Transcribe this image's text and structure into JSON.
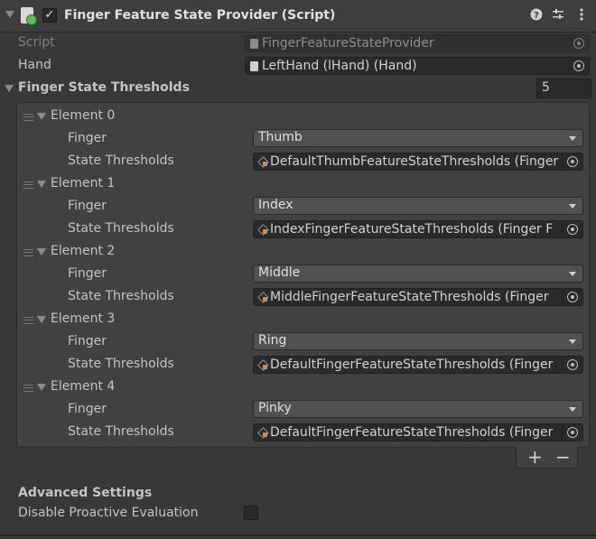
{
  "component": {
    "title": "Finger Feature State Provider (Script)",
    "enabled": true
  },
  "fields": {
    "script_label": "Script",
    "script_value": "FingerFeatureStateProvider",
    "hand_label": "Hand",
    "hand_value": "LeftHand (lHand) (Hand)"
  },
  "thresholds": {
    "label": "Finger State Thresholds",
    "size": "5",
    "finger_label": "Finger",
    "state_label": "State Thresholds",
    "elements": [
      {
        "name": "Element 0",
        "finger": "Thumb",
        "state": "DefaultThumbFeatureStateThresholds (Finger"
      },
      {
        "name": "Element 1",
        "finger": "Index",
        "state": "IndexFingerFeatureStateThresholds (Finger F"
      },
      {
        "name": "Element 2",
        "finger": "Middle",
        "state": "MiddleFingerFeatureStateThresholds (Finger"
      },
      {
        "name": "Element 3",
        "finger": "Ring",
        "state": "DefaultFingerFeatureStateThresholds (Finger"
      },
      {
        "name": "Element 4",
        "finger": "Pinky",
        "state": "DefaultFingerFeatureStateThresholds (Finger"
      }
    ],
    "add_label": "+",
    "remove_label": "−"
  },
  "advanced": {
    "heading": "Advanced Settings",
    "disable_proactive_label": "Disable Proactive Evaluation",
    "disable_proactive_checked": false
  },
  "icons": {
    "help": "help-icon",
    "presets": "presets-icon",
    "menu": "kebab-menu-icon"
  }
}
